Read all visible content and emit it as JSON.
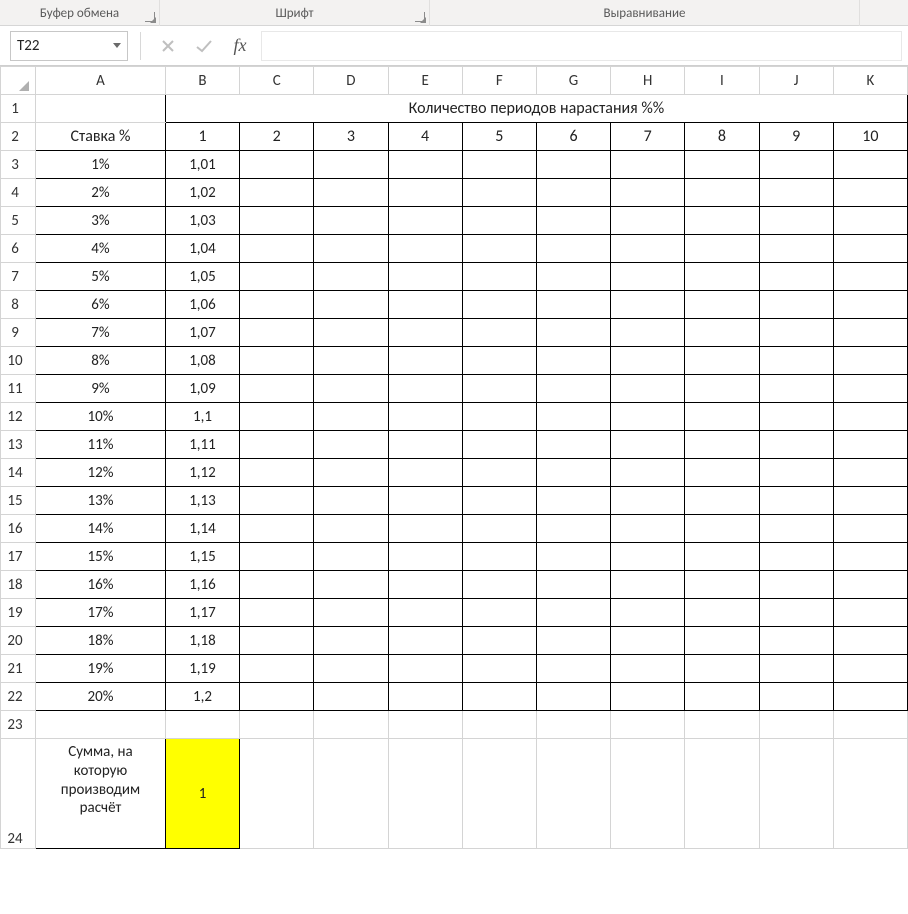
{
  "ribbon": {
    "group1": "Буфер обмена",
    "group2": "Шрифт",
    "group3": "Выравнивание"
  },
  "formula_bar": {
    "name_box": "T22",
    "fx_label": "fx",
    "formula": ""
  },
  "columns": [
    "A",
    "B",
    "C",
    "D",
    "E",
    "F",
    "G",
    "H",
    "I",
    "J",
    "K"
  ],
  "rows": [
    "1",
    "2",
    "3",
    "4",
    "5",
    "6",
    "7",
    "8",
    "9",
    "10",
    "11",
    "12",
    "13",
    "14",
    "15",
    "16",
    "17",
    "18",
    "19",
    "20",
    "21",
    "22",
    "23",
    "24"
  ],
  "sheet": {
    "title_merged": "Количество периодов нарастания %%",
    "header_A": "Ставка %",
    "periods": [
      "1",
      "2",
      "3",
      "4",
      "5",
      "6",
      "7",
      "8",
      "9",
      "10"
    ],
    "rates": [
      "1%",
      "2%",
      "3%",
      "4%",
      "5%",
      "6%",
      "7%",
      "8%",
      "9%",
      "10%",
      "11%",
      "12%",
      "13%",
      "14%",
      "15%",
      "16%",
      "17%",
      "18%",
      "19%",
      "20%"
    ],
    "col_B": [
      "1,01",
      "1,02",
      "1,03",
      "1,04",
      "1,05",
      "1,06",
      "1,07",
      "1,08",
      "1,09",
      "1,1",
      "1,11",
      "1,12",
      "1,13",
      "1,14",
      "1,15",
      "1,16",
      "1,17",
      "1,18",
      "1,19",
      "1,2"
    ],
    "sum_label": "Сумма, на которую производим расчёт",
    "sum_value": "1"
  },
  "selected_row_header": "22"
}
